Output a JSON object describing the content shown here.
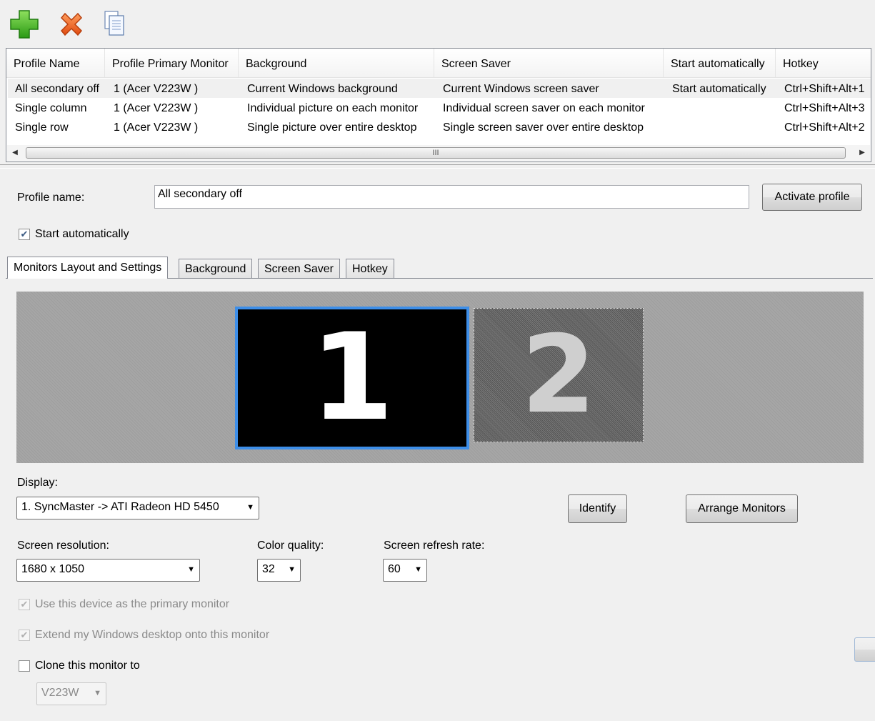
{
  "toolbar": {
    "add_icon": "plus-icon",
    "delete_icon": "x-icon",
    "copy_icon": "copy-icon"
  },
  "profiles_table": {
    "columns": [
      "Profile Name",
      "Profile Primary Monitor",
      "Background",
      "Screen Saver",
      "Start automatically",
      "Hotkey"
    ],
    "rows": [
      {
        "name": "All secondary off",
        "monitor": "1 (Acer V223W )",
        "background": "Current Windows background",
        "screensaver": "Current Windows screen saver",
        "start": "Start automatically",
        "hotkey": "Ctrl+Shift+Alt+1"
      },
      {
        "name": "Single column",
        "monitor": "1 (Acer V223W )",
        "background": "Individual picture on each monitor",
        "screensaver": "Individual screen saver on each monitor",
        "start": "",
        "hotkey": "Ctrl+Shift+Alt+3"
      },
      {
        "name": "Single row",
        "monitor": "1 (Acer V223W )",
        "background": "Single picture over entire desktop",
        "screensaver": "Single screen saver over entire desktop",
        "start": "",
        "hotkey": "Ctrl+Shift+Alt+2"
      }
    ],
    "scroll_grip": "III"
  },
  "profile": {
    "name_label": "Profile name:",
    "name_value": "All secondary off",
    "activate_label": "Activate profile",
    "start_auto_label": "Start automatically",
    "start_auto_checked": true
  },
  "tabs": [
    "Monitors Layout and Settings",
    "Background",
    "Screen Saver",
    "Hotkey"
  ],
  "monitors": {
    "monitor1_number": "1",
    "monitor2_number": "2",
    "selected": "1"
  },
  "display": {
    "label": "Display:",
    "value": "1. SyncMaster -> ATI Radeon HD 5450",
    "identify_label": "Identify",
    "arrange_label": "Arrange Monitors"
  },
  "settings": {
    "resolution_label": "Screen resolution:",
    "resolution_value": "1680 x 1050",
    "color_label": "Color quality:",
    "color_value": "32",
    "refresh_label": "Screen refresh rate:",
    "refresh_value": "60"
  },
  "options": {
    "primary_label": "Use this device as the primary monitor",
    "extend_label": "Extend my Windows desktop onto this monitor",
    "clone_label": "Clone this monitor to",
    "clone_target": "V223W"
  },
  "colors": {
    "selected_monitor_border": "#3d8ee8",
    "add_green": "#3cb91c",
    "delete_orange": "#f0641c"
  }
}
